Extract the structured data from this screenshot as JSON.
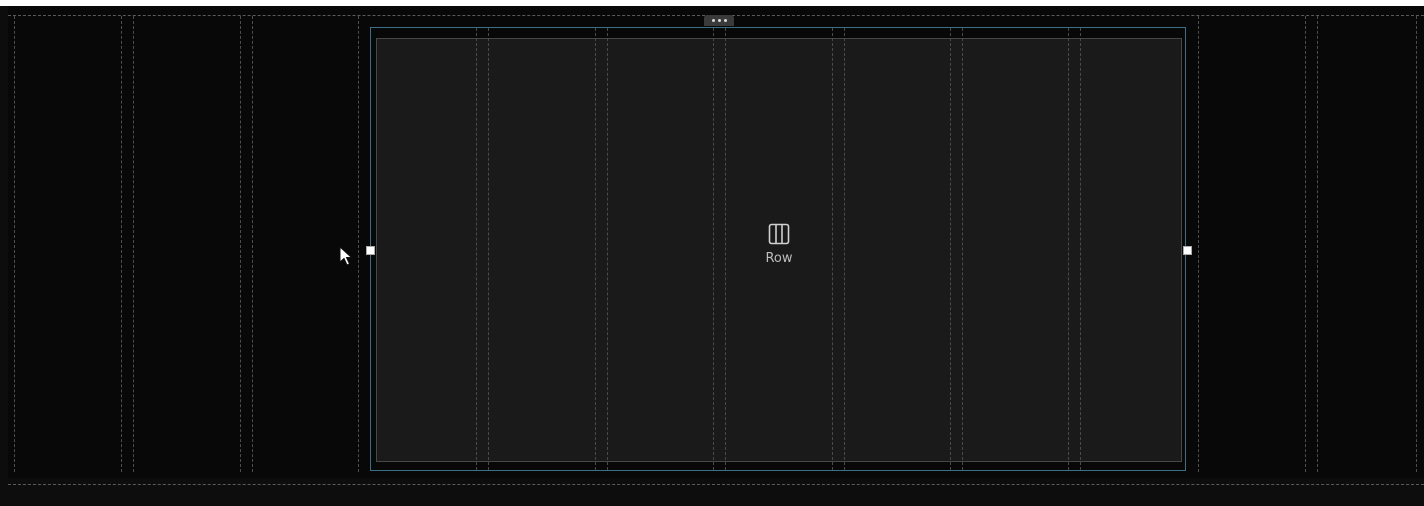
{
  "editor": {
    "selected_element": {
      "type_label": "Row",
      "icon": "columns-icon",
      "menu_icon": "more-horizontal-icon"
    },
    "colors": {
      "selection_border": "#3b6f86",
      "row_fill": "#1a1a1a",
      "section_fill": "#080808"
    }
  }
}
